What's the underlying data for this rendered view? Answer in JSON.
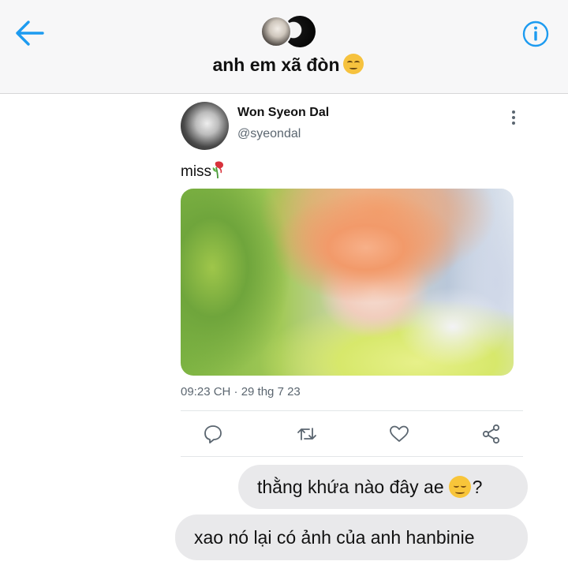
{
  "header": {
    "title": "anh em xã đòn",
    "title_emoji": "smirking-face-emoji",
    "back_icon": "chevron-left-arrow-icon",
    "info_icon": "info-circle-icon",
    "accent_color": "#1d9bf0"
  },
  "tweet": {
    "author_name": "Won Syeon Dal",
    "author_handle": "@syeondal",
    "text": "miss",
    "text_emoji": "wilted-rose-emoji",
    "timestamp": "09:23 CH · 29 thg 7 23",
    "actions": [
      "reply-icon",
      "retweet-icon",
      "like-icon",
      "share-icon"
    ]
  },
  "messages": [
    {
      "text_before": "thằng khứa nào đây ae",
      "emoji": "smiling-face-emoji",
      "text_after": "?"
    },
    {
      "text": "xao nó lại có ảnh của anh hanbinie"
    }
  ]
}
